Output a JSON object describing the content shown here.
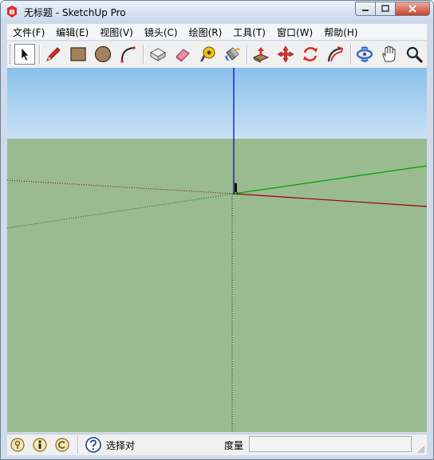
{
  "window": {
    "title": "无标题 - SketchUp Pro",
    "app_icon": "sketchup-logo-icon",
    "controls": [
      "minimize-icon",
      "maximize-icon",
      "close-icon"
    ]
  },
  "menubar": {
    "items": [
      {
        "label": "文件(F)"
      },
      {
        "label": "编辑(E)"
      },
      {
        "label": "视图(V)"
      },
      {
        "label": "镜头(C)"
      },
      {
        "label": "绘图(R)"
      },
      {
        "label": "工具(T)"
      },
      {
        "label": "窗口(W)"
      },
      {
        "label": "帮助(H)"
      }
    ]
  },
  "toolbar": {
    "tools": [
      {
        "name": "select-tool",
        "icon": "arrow-cursor-icon",
        "selected": true
      },
      {
        "name": "pencil-tool",
        "icon": "pencil-icon"
      },
      {
        "name": "rectangle-tool",
        "icon": "rectangle-icon"
      },
      {
        "name": "circle-tool",
        "icon": "circle-icon"
      },
      {
        "name": "arc-tool",
        "icon": "arc-icon"
      },
      {
        "name": "make-component-tool",
        "icon": "component-box-icon"
      },
      {
        "name": "eraser-tool",
        "icon": "eraser-icon"
      },
      {
        "name": "tape-measure-tool",
        "icon": "tape-measure-icon"
      },
      {
        "name": "paint-bucket-tool",
        "icon": "paint-bucket-icon"
      },
      {
        "name": "push-pull-tool",
        "icon": "push-pull-icon"
      },
      {
        "name": "move-tool",
        "icon": "move-arrows-icon"
      },
      {
        "name": "rotate-tool",
        "icon": "rotate-icon"
      },
      {
        "name": "follow-me-tool",
        "icon": "follow-me-icon"
      },
      {
        "name": "orbit-tool",
        "icon": "orbit-icon"
      },
      {
        "name": "pan-tool",
        "icon": "hand-icon"
      },
      {
        "name": "zoom-tool",
        "icon": "magnifier-icon"
      }
    ]
  },
  "viewport": {
    "sky_color": "#a9d1f2",
    "ground_color": "#99bb8f",
    "axes": {
      "red": "#b00000",
      "green": "#00a000",
      "blue": "#0000b0"
    }
  },
  "statusbar": {
    "icons": [
      "geo-location-icon",
      "credits-info-icon",
      "copyright-icon",
      "help-icon"
    ],
    "status_text": "选择对",
    "measurements_label": "度量",
    "measurements_value": ""
  }
}
